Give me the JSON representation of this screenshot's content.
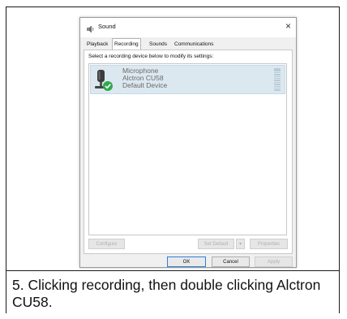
{
  "dialog": {
    "title": "Sound",
    "close_glyph": "×",
    "icon": "speaker-icon",
    "tabs": [
      "Playback",
      "Recording",
      "Sounds",
      "Communications"
    ],
    "active_tab": "Recording",
    "instruction": "Select a recording device below to modify its settings:",
    "devices": [
      {
        "name": "Microphone",
        "description": "Alctron CU58",
        "status": "Default Device",
        "icon": "microphone-icon",
        "badge": "check-icon"
      }
    ],
    "buttons": {
      "configure": "Configure",
      "set_default": "Set Default",
      "dropdown": "▾",
      "properties": "Properties",
      "ok": "OK",
      "cancel": "Cancel",
      "apply": "Apply"
    },
    "colors": {
      "check_badge": "#2fa84f",
      "selected_row": "#dce8f0",
      "default_button_border": "#2f7fd6"
    }
  },
  "caption": "5. Clicking recording, then double clicking Alctron CU58."
}
